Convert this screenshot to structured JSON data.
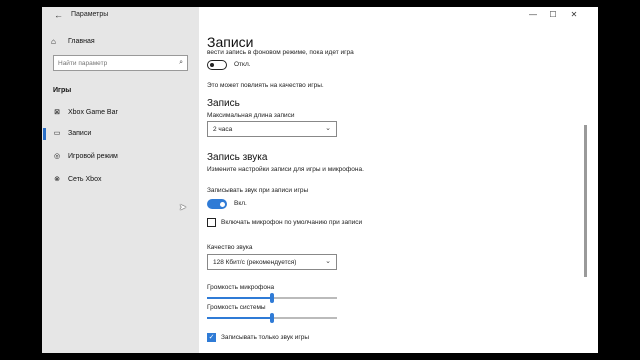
{
  "app": {
    "title": "Параметры",
    "minimize": "—",
    "maximize": "☐",
    "close": "✕"
  },
  "sidebar": {
    "home_label": "Главная",
    "search_placeholder": "Найти параметр",
    "section": "Игры",
    "items": [
      {
        "label": "Xbox Game Bar",
        "active": false
      },
      {
        "label": "Записи",
        "active": true
      },
      {
        "label": "Игровой режим",
        "active": false
      },
      {
        "label": "Сеть Xbox",
        "active": false
      }
    ]
  },
  "content": {
    "page_title": "Записи",
    "background_text": "вести запись в фоновом режиме, пока идет игра",
    "background_toggle": {
      "state": "Откл.",
      "on": false
    },
    "quality_note": "Это может повлиять на качество игры.",
    "record_heading": "Запись",
    "max_length_label": "Максимальная длина записи",
    "max_length_value": "2 часа",
    "audio_heading": "Запись звука",
    "audio_desc": "Измените настройки записи для игры и микрофона.",
    "audio_record_label": "Записывать звук при записи игры",
    "audio_toggle": {
      "state": "Вкл.",
      "on": true
    },
    "mic_checkbox": {
      "label": "Включать микрофон по умолчанию при записи",
      "checked": false
    },
    "audio_quality_label": "Качество звука",
    "audio_quality_value": "128 Кбит/с (рекомендуется)",
    "mic_volume": {
      "label": "Громкость микрофона",
      "value": 0.5
    },
    "system_volume": {
      "label": "Громкость системы",
      "value": 0.5
    },
    "game_audio_only": {
      "label": "Записывать только звук игры",
      "checked": true
    }
  },
  "colors": {
    "accent": "#2f7bd6",
    "sidebar_bg": "#e6e6e6"
  }
}
